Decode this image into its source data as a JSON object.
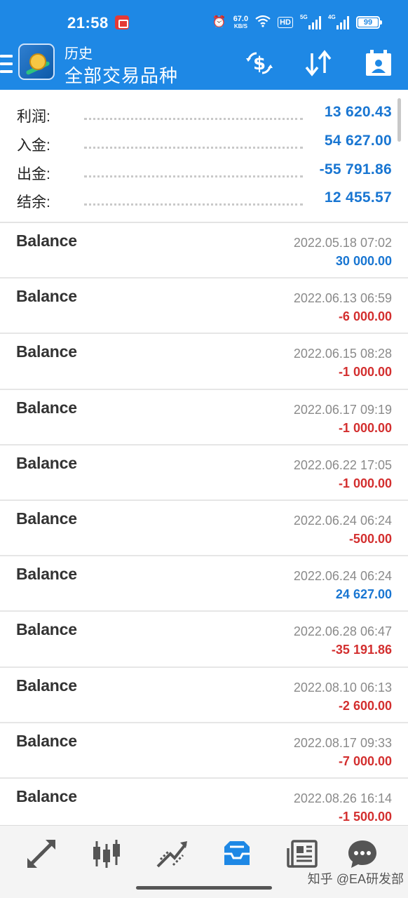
{
  "status_bar": {
    "time": "21:58",
    "net_speed": "67.0",
    "net_unit": "KB/S",
    "hd_label": "HD",
    "sig1_label": "5G",
    "sig2_label": "4G",
    "battery": "99"
  },
  "app_bar": {
    "title": "历史",
    "subtitle": "全部交易品种"
  },
  "summary": [
    {
      "label": "利润:",
      "value": "13 620.43"
    },
    {
      "label": "入金:",
      "value": "54 627.00"
    },
    {
      "label": "出金:",
      "value": "-55 791.86"
    },
    {
      "label": "结余:",
      "value": "12 455.57"
    }
  ],
  "deals": [
    {
      "type": "Balance",
      "time": "2022.05.18 07:02",
      "amount": "30 000.00",
      "sign": "pos"
    },
    {
      "type": "Balance",
      "time": "2022.06.13 06:59",
      "amount": "-6 000.00",
      "sign": "neg"
    },
    {
      "type": "Balance",
      "time": "2022.06.15 08:28",
      "amount": "-1 000.00",
      "sign": "neg"
    },
    {
      "type": "Balance",
      "time": "2022.06.17 09:19",
      "amount": "-1 000.00",
      "sign": "neg"
    },
    {
      "type": "Balance",
      "time": "2022.06.22 17:05",
      "amount": "-1 000.00",
      "sign": "neg"
    },
    {
      "type": "Balance",
      "time": "2022.06.24 06:24",
      "amount": "-500.00",
      "sign": "neg"
    },
    {
      "type": "Balance",
      "time": "2022.06.24 06:24",
      "amount": "24 627.00",
      "sign": "pos"
    },
    {
      "type": "Balance",
      "time": "2022.06.28 06:47",
      "amount": "-35 191.86",
      "sign": "neg"
    },
    {
      "type": "Balance",
      "time": "2022.08.10 06:13",
      "amount": "-2 600.00",
      "sign": "neg"
    },
    {
      "type": "Balance",
      "time": "2022.08.17 09:33",
      "amount": "-7 000.00",
      "sign": "neg"
    },
    {
      "type": "Balance",
      "time": "2022.08.26 16:14",
      "amount": "-1 500.00",
      "sign": "neg"
    }
  ],
  "bottom_nav": {
    "items": [
      {
        "icon": "quotes-arrows-icon",
        "active": false
      },
      {
        "icon": "candlestick-chart-icon",
        "active": false
      },
      {
        "icon": "trade-lines-icon",
        "active": false
      },
      {
        "icon": "history-inbox-icon",
        "active": true
      },
      {
        "icon": "news-icon",
        "active": false
      },
      {
        "icon": "chat-icon",
        "active": false
      }
    ],
    "watermark": "知乎 @EA研发部"
  },
  "colors": {
    "primary": "#1e88e5",
    "positive": "#1976d2",
    "negative": "#d32f2f",
    "nav_active": "#1e88e5",
    "nav_inactive": "#555555"
  }
}
